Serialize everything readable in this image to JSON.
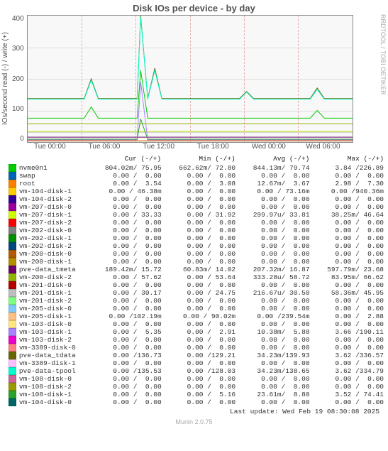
{
  "title": "Disk IOs per device - by day",
  "ylabel": "IOs/second read (-) / write (+)",
  "rightlabel": "RRDTOOL / TOBI OETIKER",
  "yaxis": [
    "400",
    "300",
    "200",
    "100",
    "0"
  ],
  "xaxis": [
    "Tue 00:00",
    "Tue 06:00",
    "Tue 12:00",
    "Tue 18:00",
    "Wed 00:00",
    "Wed 06:00"
  ],
  "header": {
    "name": "",
    "cur": "Cur (-/+)",
    "min": "Min (-/+)",
    "avg": "Avg (-/+)",
    "max": "Max (-/+)"
  },
  "legend": [
    {
      "color": "#00cc00",
      "name": "nvme0n1",
      "cur": "804.02m/ 75.95",
      "min": "662.62m/ 72.80",
      "avg": "844.13m/ 79.74",
      "max": "  3.84 /226.89"
    },
    {
      "color": "#0066b3",
      "name": "swap",
      "cur": "  0.00 /  0.00",
      "min": "  0.00 /  0.00",
      "avg": "  0.00 /  0.00",
      "max": "  0.00 /  0.00"
    },
    {
      "color": "#ff8000",
      "name": "root",
      "cur": "  0.00 /  3.54",
      "min": "  0.00 /  3.08",
      "avg": " 12.67m/  3.67",
      "max": "  2.98 /  7.30"
    },
    {
      "color": "#ffcc00",
      "name": "vm-104-disk-1",
      "cur": "  0.00 / 46.38m",
      "min": "  0.00 /  0.00",
      "avg": "  0.00 / 73.16m",
      "max": "  0.00 /940.36m"
    },
    {
      "color": "#330099",
      "name": "vm-104-disk-2",
      "cur": "  0.00 /  0.00",
      "min": "  0.00 /  0.00",
      "avg": "  0.00 /  0.00",
      "max": "  0.00 /  0.00"
    },
    {
      "color": "#990099",
      "name": "vm-207-disk-0",
      "cur": "  0.00 /  0.00",
      "min": "  0.00 /  0.00",
      "avg": "  0.00 /  0.00",
      "max": "  0.00 /  0.00"
    },
    {
      "color": "#ccff00",
      "name": "vm-207-disk-1",
      "cur": "  0.00 / 33.33",
      "min": "  0.00 / 31.92",
      "avg": "299.97u/ 33.81",
      "max": " 38.25m/ 46.64"
    },
    {
      "color": "#ff0000",
      "name": "vm-207-disk-2",
      "cur": "  0.00 /  0.00",
      "min": "  0.00 /  0.00",
      "avg": "  0.00 /  0.00",
      "max": "  0.00 /  0.00"
    },
    {
      "color": "#808080",
      "name": "vm-202-disk-0",
      "cur": "  0.00 /  0.00",
      "min": "  0.00 /  0.00",
      "avg": "  0.00 /  0.00",
      "max": "  0.00 /  0.00"
    },
    {
      "color": "#008f00",
      "name": "vm-202-disk-1",
      "cur": "  0.00 /  0.00",
      "min": "  0.00 /  0.00",
      "avg": "  0.00 /  0.00",
      "max": "  0.00 /  0.00"
    },
    {
      "color": "#00487d",
      "name": "vm-202-disk-2",
      "cur": "  0.00 /  0.00",
      "min": "  0.00 /  0.00",
      "avg": "  0.00 /  0.00",
      "max": "  0.00 /  0.00"
    },
    {
      "color": "#b35a00",
      "name": "vm-200-disk-0",
      "cur": "  0.00 /  0.00",
      "min": "  0.00 /  0.00",
      "avg": "  0.00 /  0.00",
      "max": "  0.00 /  0.00"
    },
    {
      "color": "#b38f00",
      "name": "vm-200-disk-1",
      "cur": "  0.00 /  0.00",
      "min": "  0.00 /  0.00",
      "avg": "  0.00 /  0.00",
      "max": "  0.00 /  0.00"
    },
    {
      "color": "#6b006b",
      "name": "pve-data_tmeta",
      "cur": "189.42m/ 15.72",
      "min": " 60.83m/ 14.02",
      "avg": "207.32m/ 16.87",
      "max": "597.79m/ 23.68"
    },
    {
      "color": "#8fb300",
      "name": "vm-200-disk-2",
      "cur": "  0.00 / 57.62",
      "min": "  0.00 / 53.64",
      "avg": "333.28u/ 58.72",
      "max": " 83.95m/ 66.62"
    },
    {
      "color": "#b30000",
      "name": "vm-201-disk-0",
      "cur": "  0.00 /  0.00",
      "min": "  0.00 /  0.00",
      "avg": "  0.00 /  0.00",
      "max": "  0.00 /  0.00"
    },
    {
      "color": "#bebebe",
      "name": "vm-201-disk-1",
      "cur": "  0.00 / 30.17",
      "min": "  0.00 / 24.75",
      "avg": "216.67u/ 30.50",
      "max": " 58.36m/ 45.95"
    },
    {
      "color": "#80ff80",
      "name": "vm-201-disk-2",
      "cur": "  0.00 /  0.00",
      "min": "  0.00 /  0.00",
      "avg": "  0.00 /  0.00",
      "max": "  0.00 /  0.00"
    },
    {
      "color": "#80c9ff",
      "name": "vm-205-disk-0",
      "cur": "  0.00 /  0.00",
      "min": "  0.00 /  0.00",
      "avg": "  0.00 /  0.00",
      "max": "  0.00 /  0.00"
    },
    {
      "color": "#ffc080",
      "name": "vm-205-disk-1",
      "cur": "  0.00 /102.19m",
      "min": "  0.00 / 90.02m",
      "avg": "  0.00 /239.54m",
      "max": "  0.00 /  2.88"
    },
    {
      "color": "#ffe680",
      "name": "vm-103-disk-0",
      "cur": "  0.00 /  0.00",
      "min": "  0.00 /  0.00",
      "avg": "  0.00 /  0.00",
      "max": "  0.00 /  0.00"
    },
    {
      "color": "#aa80ff",
      "name": "vm-103-disk-1",
      "cur": "  0.00 /  5.35",
      "min": "  0.00 /  2.91",
      "avg": " 10.38m/  5.88",
      "max": "  3.66 /190.11"
    },
    {
      "color": "#ee00cc",
      "name": "vm-103-disk-2",
      "cur": "  0.00 /  0.00",
      "min": "  0.00 /  0.00",
      "avg": "  0.00 /  0.00",
      "max": "  0.00 /  0.00"
    },
    {
      "color": "#ff8080",
      "name": "vm-3389-disk-0",
      "cur": "  0.00 /  0.00",
      "min": "  0.00 /  0.00",
      "avg": "  0.00 /  0.00",
      "max": "  0.00 /  0.00"
    },
    {
      "color": "#666600",
      "name": "pve-data_tdata",
      "cur": "  0.00 /136.73",
      "min": "  0.00 /129.21",
      "avg": " 34.23m/139.93",
      "max": "  3.62 /336.57"
    },
    {
      "color": "#ffbfff",
      "name": "vm-3389-disk-1",
      "cur": "  0.00 /  0.00",
      "min": "  0.00 /  0.00",
      "avg": "  0.00 /  0.00",
      "max": "  0.00 /  0.00"
    },
    {
      "color": "#00ffcc",
      "name": "pve-data-tpool",
      "cur": "  0.00 /135.53",
      "min": "  0.00 /128.03",
      "avg": " 34.23m/138.65",
      "max": "  3.62 /334.79"
    },
    {
      "color": "#cc6699",
      "name": "vm-108-disk-0",
      "cur": "  0.00 /  0.00",
      "min": "  0.00 /  0.00",
      "avg": "  0.00 /  0.00",
      "max": "  0.00 /  0.00"
    },
    {
      "color": "#999900",
      "name": "vm-108-disk-2",
      "cur": "  0.00 /  0.00",
      "min": "  0.00 /  0.00",
      "avg": "  0.00 /  0.00",
      "max": "  0.00 /  0.00"
    },
    {
      "color": "#29a329",
      "name": "vm-108-disk-1",
      "cur": "  0.00 /  0.00",
      "min": "  0.00 /  5.16",
      "avg": " 23.61m/  8.80",
      "max": "  3.52 / 74.41"
    },
    {
      "color": "#006666",
      "name": "vm-104-disk-0",
      "cur": "  0.00 /  0.00",
      "min": "  0.00 /  0.00",
      "avg": "  0.00 /  0.00",
      "max": "  0.00 /  0.00"
    }
  ],
  "last_update": "Last update: Wed Feb 19 08:30:08 2025",
  "munin": "Munin 2.0.75",
  "chart_data": {
    "type": "line",
    "xlabel": "",
    "ylabel": "IOs/second read (-) / write (+)",
    "ylim": [
      0,
      400
    ],
    "x_range": [
      "Tue 00:00",
      "Wed 08:30"
    ],
    "note": "Time-series; values below are approximate visual baselines and spike peaks read from the plot. Most series sit near 0.",
    "series": [
      {
        "name": "pve-data_tdata",
        "baseline": 137,
        "spikes": [
          {
            "t": "Tue 06:30",
            "v": 200
          },
          {
            "t": "Tue 11:30",
            "v": 400
          },
          {
            "t": "Tue 12:00",
            "v": 230
          },
          {
            "t": "Tue 22:00",
            "v": 160
          },
          {
            "t": "Wed 05:00",
            "v": 170
          }
        ]
      },
      {
        "name": "pve-data-tpool",
        "baseline": 135,
        "spikes": [
          {
            "t": "Tue 06:30",
            "v": 200
          },
          {
            "t": "Tue 11:30",
            "v": 395
          },
          {
            "t": "Tue 12:00",
            "v": 225
          },
          {
            "t": "Tue 22:00",
            "v": 158
          },
          {
            "t": "Wed 05:00",
            "v": 168
          }
        ]
      },
      {
        "name": "nvme0n1",
        "baseline": 76,
        "spikes": [
          {
            "t": "Tue 06:30",
            "v": 110
          },
          {
            "t": "Tue 11:30",
            "v": 227
          },
          {
            "t": "Wed 05:00",
            "v": 100
          }
        ]
      },
      {
        "name": "vm-200-disk-2",
        "baseline": 58,
        "spikes": [
          {
            "t": "Tue 11:30",
            "v": 67
          }
        ]
      },
      {
        "name": "vm-207-disk-1",
        "baseline": 33,
        "spikes": [
          {
            "t": "Tue 11:30",
            "v": 47
          }
        ]
      },
      {
        "name": "vm-201-disk-1",
        "baseline": 30,
        "spikes": [
          {
            "t": "Tue 11:30",
            "v": 46
          }
        ]
      },
      {
        "name": "pve-data_tmeta",
        "baseline": 16,
        "spikes": [
          {
            "t": "Tue 11:30",
            "v": 24
          }
        ]
      },
      {
        "name": "vm-108-disk-1",
        "baseline": 9,
        "spikes": [
          {
            "t": "Tue 11:30",
            "v": 74
          }
        ]
      },
      {
        "name": "vm-103-disk-1",
        "baseline": 6,
        "spikes": [
          {
            "t": "Tue 11:30",
            "v": 190
          }
        ]
      },
      {
        "name": "root",
        "baseline": 3.5,
        "spikes": [
          {
            "t": "Tue 11:30",
            "v": 7
          }
        ]
      }
    ]
  }
}
